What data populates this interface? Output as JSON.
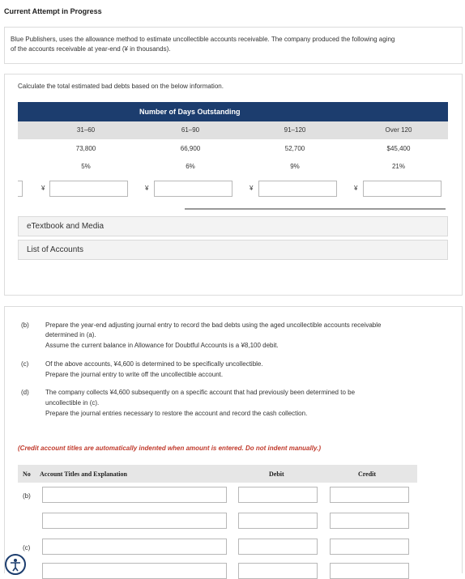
{
  "header": {
    "title": "Current Attempt in Progress"
  },
  "problem": {
    "intro": [
      "Blue Publishers, uses the allowance method to estimate uncollectible accounts receivable. The company produced the following aging",
      "of the accounts receivable at year-end (¥ in thousands)."
    ]
  },
  "part_a": {
    "instruction": "Calculate the total estimated bad debts based on the below information.",
    "table_title": "Number of Days Outstanding",
    "columns": [
      {
        "label": "31–60",
        "amount": "73,800",
        "pct": "5%"
      },
      {
        "label": "61–90",
        "amount": "66,900",
        "pct": "6%"
      },
      {
        "label": "91–120",
        "amount": "52,700",
        "pct": "9%"
      },
      {
        "label": "Over 120",
        "amount": "$45,400",
        "pct": "21%"
      }
    ],
    "currency_symbol": "¥",
    "inputs": [
      "",
      "",
      "",
      ""
    ],
    "links": {
      "etextbook": "eTextbook and Media",
      "accounts": "List of Accounts"
    }
  },
  "parts": [
    {
      "label": "(b)",
      "lines": [
        "Prepare the year-end adjusting journal entry to record the bad debts using the aged uncollectible accounts receivable",
        "determined in (a).",
        "Assume the current balance in Allowance for Doubtful Accounts is a ¥8,100 debit."
      ]
    },
    {
      "label": "(c)",
      "lines": [
        "Of the above accounts, ¥4,600 is determined to be specifically uncollectible.",
        "Prepare the journal entry to write off the uncollectible account."
      ]
    },
    {
      "label": "(d)",
      "lines": [
        "The company collects ¥4,600 subsequently on a specific account that had previously been determined to be",
        "uncollectible in (c).",
        "Prepare the journal entries necessary to restore the account and record the cash collection."
      ]
    }
  ],
  "journal": {
    "note": "(Credit account titles are automatically indented when amount is entered. Do not indent manually.)",
    "headers": {
      "no": "No",
      "title": "Account Titles and Explanation",
      "debit": "Debit",
      "credit": "Credit"
    },
    "rows": [
      {
        "no": "(b)",
        "account": "",
        "debit": "",
        "credit": ""
      },
      {
        "no": "",
        "account": "",
        "debit": "",
        "credit": ""
      },
      {
        "no": "(c)",
        "account": "",
        "debit": "",
        "credit": ""
      },
      {
        "no": "",
        "account": "",
        "debit": "",
        "credit": ""
      }
    ]
  },
  "colors": {
    "header_navy": "#1c3d6e",
    "note_red": "#c0392b",
    "border": "#dcdcdc"
  }
}
